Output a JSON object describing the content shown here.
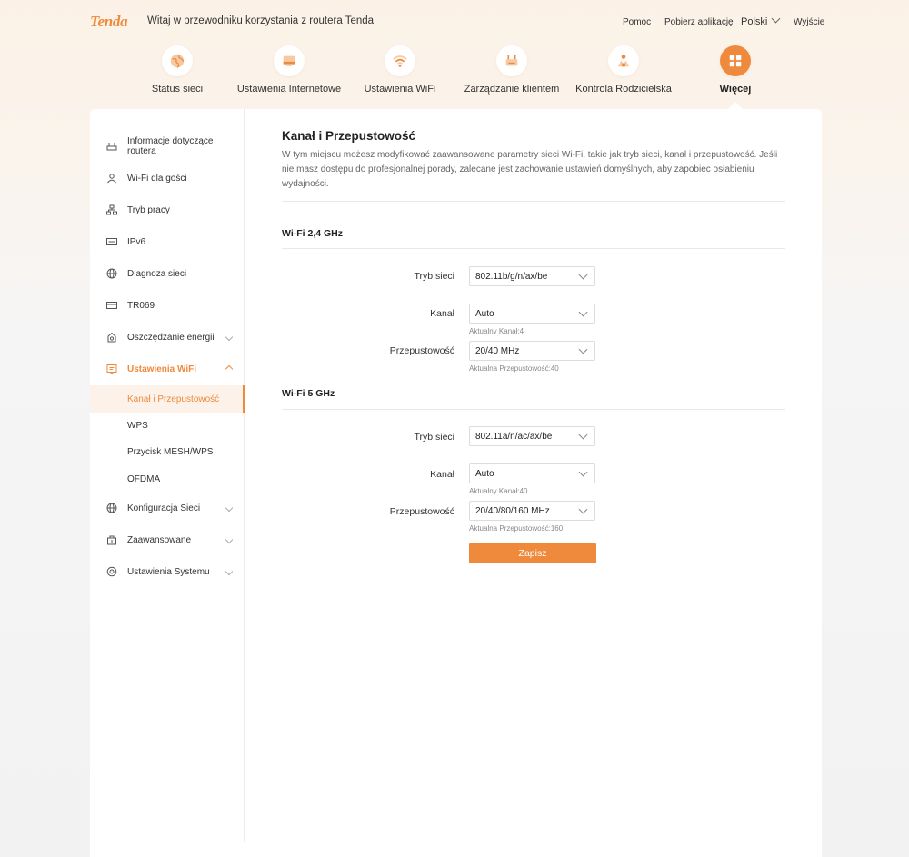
{
  "header": {
    "logo": "Tenda",
    "welcome": "Witaj w przewodniku korzystania z routera Tenda",
    "links": {
      "help": "Pomoc",
      "download_app": "Pobierz aplikację",
      "language": "Polski",
      "exit": "Wyjście"
    }
  },
  "nav": {
    "items": [
      {
        "label": "Status sieci",
        "icon": "globe-icon"
      },
      {
        "label": "Ustawienia Internetowe",
        "icon": "internet-icon"
      },
      {
        "label": "Ustawienia WiFi",
        "icon": "wifi-icon"
      },
      {
        "label": "Zarządzanie klientem",
        "icon": "router-icon"
      },
      {
        "label": "Kontrola Rodzicielska",
        "icon": "family-icon"
      },
      {
        "label": "Więcej",
        "icon": "grid-icon",
        "active": true
      }
    ]
  },
  "sidebar": {
    "items": [
      {
        "label": "Informacje dotyczące routera",
        "icon": "router-info-icon"
      },
      {
        "label": "Wi-Fi dla gości",
        "icon": "guest-icon"
      },
      {
        "label": "Tryb pracy",
        "icon": "network-mode-icon"
      },
      {
        "label": "IPv6",
        "icon": "ipv6-icon"
      },
      {
        "label": "Diagnoza sieci",
        "icon": "globe-icon"
      },
      {
        "label": "TR069",
        "icon": "tr069-icon"
      },
      {
        "label": "Oszczędzanie energii",
        "icon": "energy-icon"
      },
      {
        "label": "Ustawienia WiFi",
        "icon": "wifi-settings-icon"
      },
      {
        "label": "Konfiguracja Sieci",
        "icon": "globe-icon"
      },
      {
        "label": "Zaawansowane",
        "icon": "advanced-icon"
      },
      {
        "label": "Ustawienia Systemu",
        "icon": "system-icon"
      }
    ],
    "wifi_subitems": [
      {
        "label": "Kanał i Przepustowość",
        "active": true
      },
      {
        "label": "WPS"
      },
      {
        "label": "Przycisk MESH/WPS"
      },
      {
        "label": "OFDMA"
      }
    ]
  },
  "main": {
    "title": "Kanał i Przepustowość",
    "description": "W tym miejscu możesz modyfikować zaawansowane parametry sieci Wi-Fi, takie jak tryb sieci, kanał i przepustowość. Jeśli nie masz dostępu do profesjonalnej porady, zalecane jest zachowanie ustawień domyślnych, aby zapobiec osłabieniu wydajności.",
    "band24": {
      "title": "Wi-Fi 2,4 GHz",
      "mode_label": "Tryb sieci",
      "mode_value": "802.11b/g/n/ax/be",
      "channel_label": "Kanał",
      "channel_value": "Auto",
      "channel_hint": "Aktualny Kanał:4",
      "bandwidth_label": "Przepustowość",
      "bandwidth_value": "20/40 MHz",
      "bandwidth_hint": "Aktualna Przepustowość:40"
    },
    "band5": {
      "title": "Wi-Fi 5 GHz",
      "mode_label": "Tryb sieci",
      "mode_value": "802.11a/n/ac/ax/be",
      "channel_label": "Kanał",
      "channel_value": "Auto",
      "channel_hint": "Aktualny Kanał:40",
      "bandwidth_label": "Przepustowość",
      "bandwidth_value": "20/40/80/160 MHz",
      "bandwidth_hint": "Aktualna Przepustowość:160"
    },
    "save_label": "Zapisz"
  },
  "colors": {
    "accent": "#ef8a3d",
    "accent_light": "#fdf2e9",
    "icon_light": "#f4b98d"
  }
}
